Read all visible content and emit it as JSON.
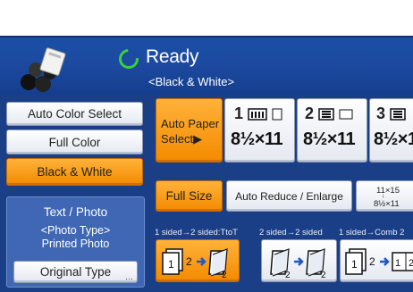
{
  "status": {
    "ready": "Ready",
    "mode": "<Black & White>"
  },
  "color_modes": [
    {
      "label": "Auto Color Select",
      "selected": false
    },
    {
      "label": "Full Color",
      "selected": false
    },
    {
      "label": "Black & White",
      "selected": true
    }
  ],
  "original_type": {
    "current": "Text / Photo",
    "photo_type_caption": "<Photo Type>",
    "photo_type_value": "Printed Photo",
    "button_label": "Original Type"
  },
  "paper": {
    "auto_label_line1": "Auto Paper",
    "auto_label_line2": "Select▶",
    "trays": [
      {
        "number": "1",
        "size": "8½×11"
      },
      {
        "number": "2",
        "size": "8½×11"
      },
      {
        "number": "3",
        "size": "8½×1"
      }
    ]
  },
  "reduce": {
    "full_size": "Full Size",
    "auto_reduce": "Auto Reduce / Enlarge",
    "ratio_top": "11×15",
    "ratio_bottom": "8½×11"
  },
  "duplex": {
    "labels": [
      "1 sided→2 sided:TtoT",
      "2 sided→2 sided",
      "1 sided→Comb 2"
    ]
  },
  "colors": {
    "accent_orange": "#f6930e",
    "header_blue": "#1a4fa6",
    "panel_blue": "#1b3f86",
    "ready_green": "#38d13a"
  }
}
